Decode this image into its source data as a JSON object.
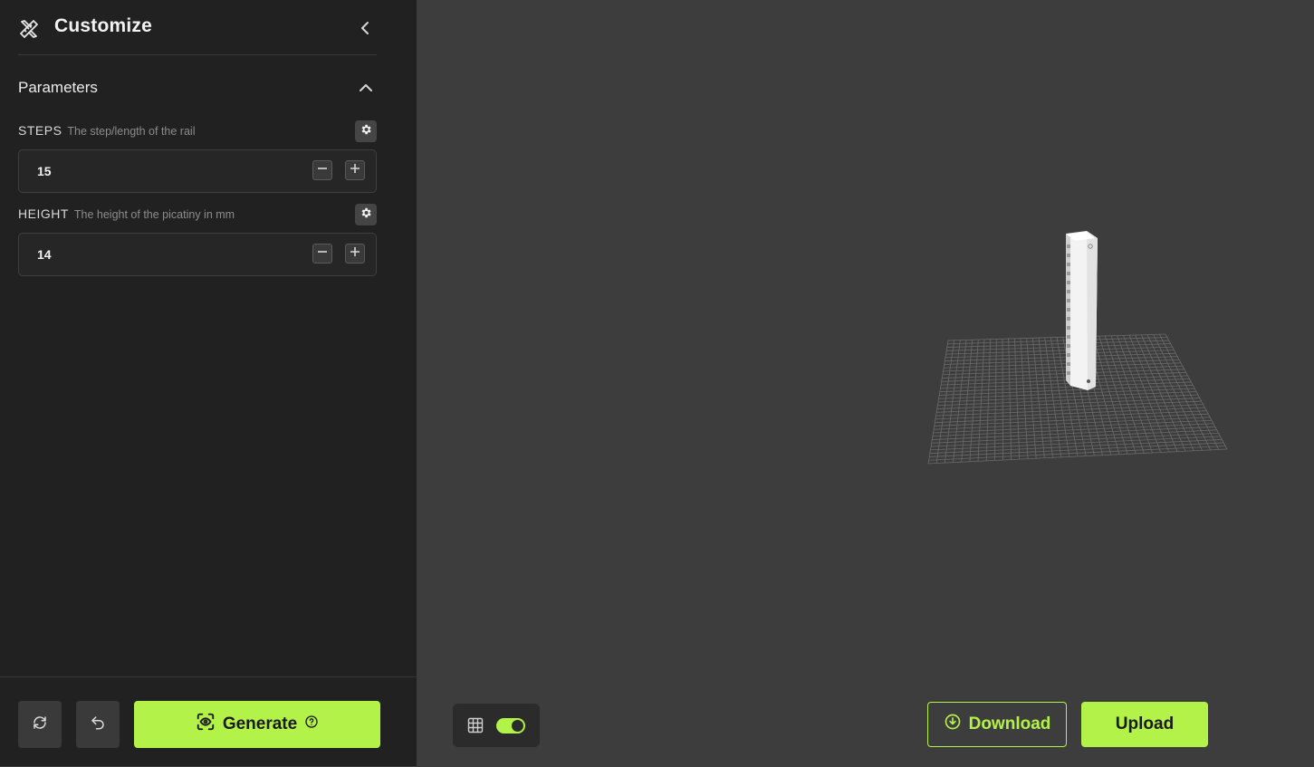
{
  "sidebar": {
    "title": "Customize",
    "section_label": "Parameters",
    "params": [
      {
        "name": "STEPS",
        "description": "The step/length of the rail",
        "value": "15"
      },
      {
        "name": "HEIGHT",
        "description": "The height of the picatiny in mm",
        "value": "14"
      }
    ],
    "footer": {
      "generate_label": "Generate"
    }
  },
  "viewport": {
    "grid_toggle_on": true,
    "download_label": "Download",
    "upload_label": "Upload"
  },
  "colors": {
    "accent": "#b3f249",
    "sidebar_bg": "#212121",
    "viewport_bg": "#3d3d3d"
  },
  "icons": {
    "header": "pencil-ruler-icon",
    "collapse": "chevron-left-icon",
    "section": "chevron-up-icon",
    "settings": "gear-icon",
    "decrement": "minus-icon",
    "increment": "plus-icon",
    "reset": "refresh-icon",
    "undo": "undo-icon",
    "generate": "eye-scan-icon",
    "help": "question-circle-icon",
    "grid": "grid-icon",
    "download": "download-circle-icon"
  }
}
